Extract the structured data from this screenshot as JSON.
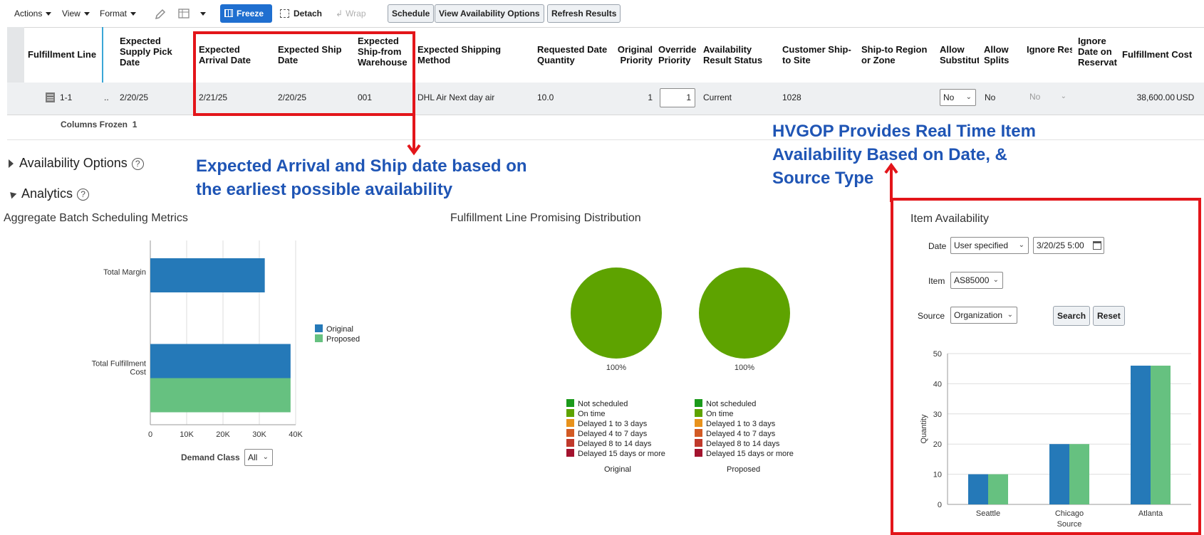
{
  "toolbar": {
    "actions": "Actions",
    "view": "View",
    "format": "Format",
    "freeze": "Freeze",
    "detach": "Detach",
    "wrap": "Wrap",
    "schedule": "Schedule",
    "view_availability": "View Availability Options",
    "refresh": "Refresh Results"
  },
  "table": {
    "headers": {
      "fulfillment_line": "Fulfillment Line",
      "supply_pick": "Expected Supply Pick Date",
      "arrival": "Expected Arrival Date",
      "ship": "Expected Ship Date",
      "warehouse": "Expected Ship-from Warehouse",
      "method": "Expected Shipping Method",
      "req_qty": "Requested Date Quantity",
      "orig_priority": "Original Priority",
      "override_priority": "Override Priority",
      "avail_status": "Availability Result Status",
      "customer_site": "Customer Ship-to Site",
      "region": "Ship-to Region or Zone",
      "allow_subst": "Allow Substitut",
      "allow_splits": "Allow Splits",
      "ignore_res": "Ignore Reservatio",
      "ignore_date": "Ignore Date on Reservat",
      "cost": "Fulfillment Cost"
    },
    "row": {
      "line": "1-1",
      "marker": "..",
      "supply_pick": "2/20/25",
      "arrival": "2/21/25",
      "ship": "2/20/25",
      "warehouse": "001",
      "method": "DHL Air Next day air",
      "req_qty": "10.0",
      "orig_priority": "1",
      "override_priority": "1",
      "avail_status": "Current",
      "customer_site": "1028",
      "allow_subst": "No",
      "allow_splits": "No",
      "ignore_res": "No",
      "cost": "38,600.00",
      "currency": "USD"
    },
    "columns_frozen_label": "Columns Frozen",
    "columns_frozen_value": "1"
  },
  "callouts": {
    "left": "Expected Arrival and Ship date based on the earliest possible availability",
    "right": "HVGOP Provides Real Time Item Availability Based on Date, & Source Type"
  },
  "sections": {
    "availability_options": "Availability Options",
    "analytics": "Analytics"
  },
  "aggregate": {
    "title": "Aggregate Batch Scheduling Metrics",
    "demand_class_label": "Demand Class",
    "demand_class_value": "All",
    "legend": [
      "Original",
      "Proposed"
    ]
  },
  "distribution": {
    "title": "Fulfillment Line Promising Distribution",
    "legend": [
      "Not scheduled",
      "On time",
      "Delayed 1 to 3 days",
      "Delayed 4 to 7 days",
      "Delayed 8 to 14 days",
      "Delayed 15 days or more"
    ]
  },
  "item_availability": {
    "title": "Item Availability",
    "date_label": "Date",
    "date_mode": "User specified",
    "date_value": "3/20/25 5:00",
    "item_label": "Item",
    "item_value": "AS85000",
    "source_label": "Source",
    "source_value": "Organization",
    "search": "Search",
    "reset": "Reset"
  },
  "colors": {
    "original": "#2579b8",
    "proposed": "#66c180",
    "pie_green": "#5ea300",
    "callout_blue": "#1f55b5",
    "highlight_red": "#e3151a",
    "freeze_blue": "#1f6fd0",
    "legend_dist": [
      "#1b9a1b",
      "#5ea300",
      "#e8921c",
      "#d25a24",
      "#c0392b",
      "#a3132e"
    ]
  },
  "chart_data": [
    {
      "type": "bar",
      "orientation": "horizontal",
      "categories": [
        "Total Margin",
        "Total Fulfillment Cost"
      ],
      "series": [
        {
          "name": "Original",
          "values": [
            31500,
            38600
          ]
        },
        {
          "name": "Proposed",
          "values": [
            null,
            38600
          ]
        }
      ],
      "xlim": [
        0,
        40000
      ],
      "ticks": [
        "0",
        "10K",
        "20K",
        "30K",
        "40K"
      ],
      "grid": true,
      "legend": "right"
    },
    {
      "type": "pie",
      "charts": [
        {
          "label": "Original",
          "slices": [
            {
              "name": "On time",
              "value": 100
            }
          ],
          "value_label": "100%"
        },
        {
          "label": "Proposed",
          "slices": [
            {
              "name": "On time",
              "value": 100
            }
          ],
          "value_label": "100%"
        }
      ],
      "legend": "bottom"
    },
    {
      "type": "bar",
      "categories": [
        "Seattle",
        "Chicago",
        "Atlanta"
      ],
      "series": [
        {
          "values": [
            10,
            20,
            46
          ]
        },
        {
          "values": [
            10,
            20,
            46
          ]
        }
      ],
      "xlabel": "Source",
      "ylabel": "Quantity",
      "ylim": [
        0,
        50
      ],
      "yticks": [
        "0",
        "10",
        "20",
        "30",
        "40",
        "50"
      ],
      "grid": true
    }
  ]
}
